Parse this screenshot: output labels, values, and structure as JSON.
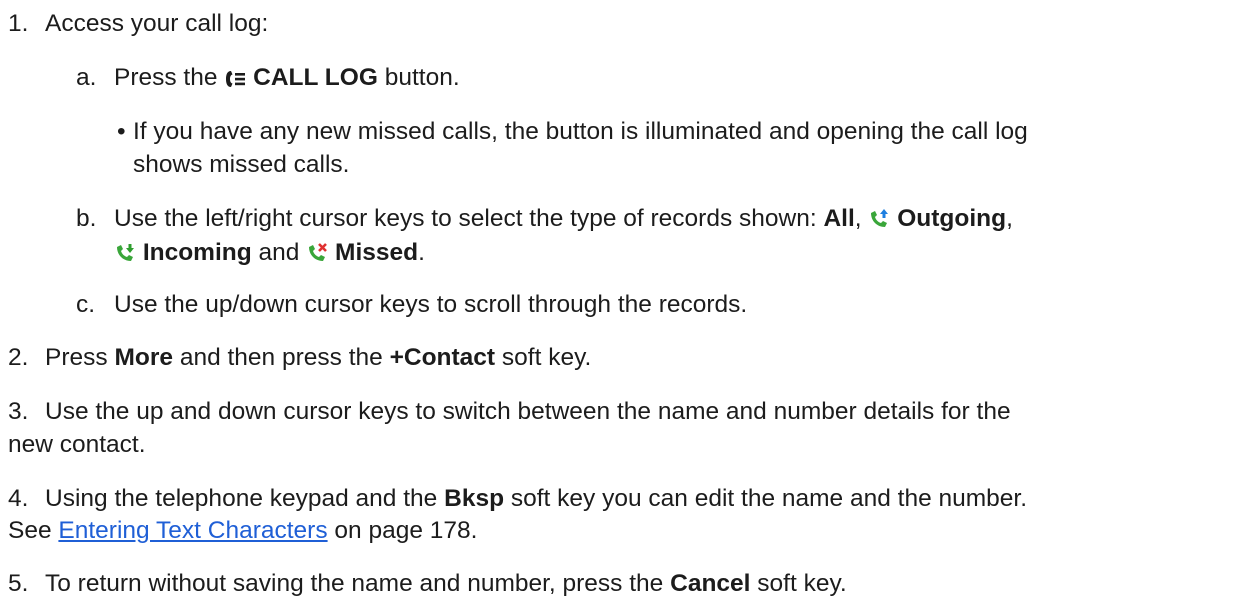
{
  "steps": {
    "s1": {
      "num": "1.",
      "text": "Access your call log:"
    },
    "s1a": {
      "num": "a.",
      "pre": "Press the",
      "bold": "CALL LOG",
      "post": "button."
    },
    "s1a_bullet": {
      "mark": "•",
      "l1": "If you have any new missed calls, the button is illuminated and opening the call log",
      "l2": "shows missed calls."
    },
    "s1b": {
      "num": "b.",
      "l1": "Use the left/right cursor keys to select the type of records shown:",
      "all": "All",
      "outgoing": "Outgoing",
      "incoming": "Incoming",
      "and": "and",
      "missed": "Missed"
    },
    "s1c": {
      "num": "c.",
      "text": "Use the up/down cursor keys to scroll through the records."
    },
    "s2": {
      "num": "2.",
      "pre": "Press",
      "more": "More",
      "mid": "and then press the",
      "contact": "+Contact",
      "post": "soft key."
    },
    "s3": {
      "num": "3.",
      "l1": "Use the up and down cursor keys to switch between the name and number details for the",
      "l2": "new contact."
    },
    "s4": {
      "num": "4.",
      "pre": "Using the telephone keypad and the",
      "bksp": "Bksp",
      "post": "soft key you can edit the name and the number.",
      "see": "See",
      "link": "Entering Text Characters",
      "page": "on page 178."
    },
    "s5": {
      "num": "5.",
      "pre": "To return without saving the name and number, press the",
      "cancel": "Cancel",
      "post": "soft key."
    }
  },
  "icons": {
    "call_log": "call-log-icon",
    "outgoing": "outgoing-call-icon",
    "incoming": "incoming-call-icon",
    "missed": "missed-call-icon"
  },
  "colors": {
    "text": "#1c1c1c",
    "link": "#1f5fd6",
    "phone_icon": "#3aa63a",
    "arrow_up": "#1f7fe0",
    "missed_x": "#e03030"
  }
}
